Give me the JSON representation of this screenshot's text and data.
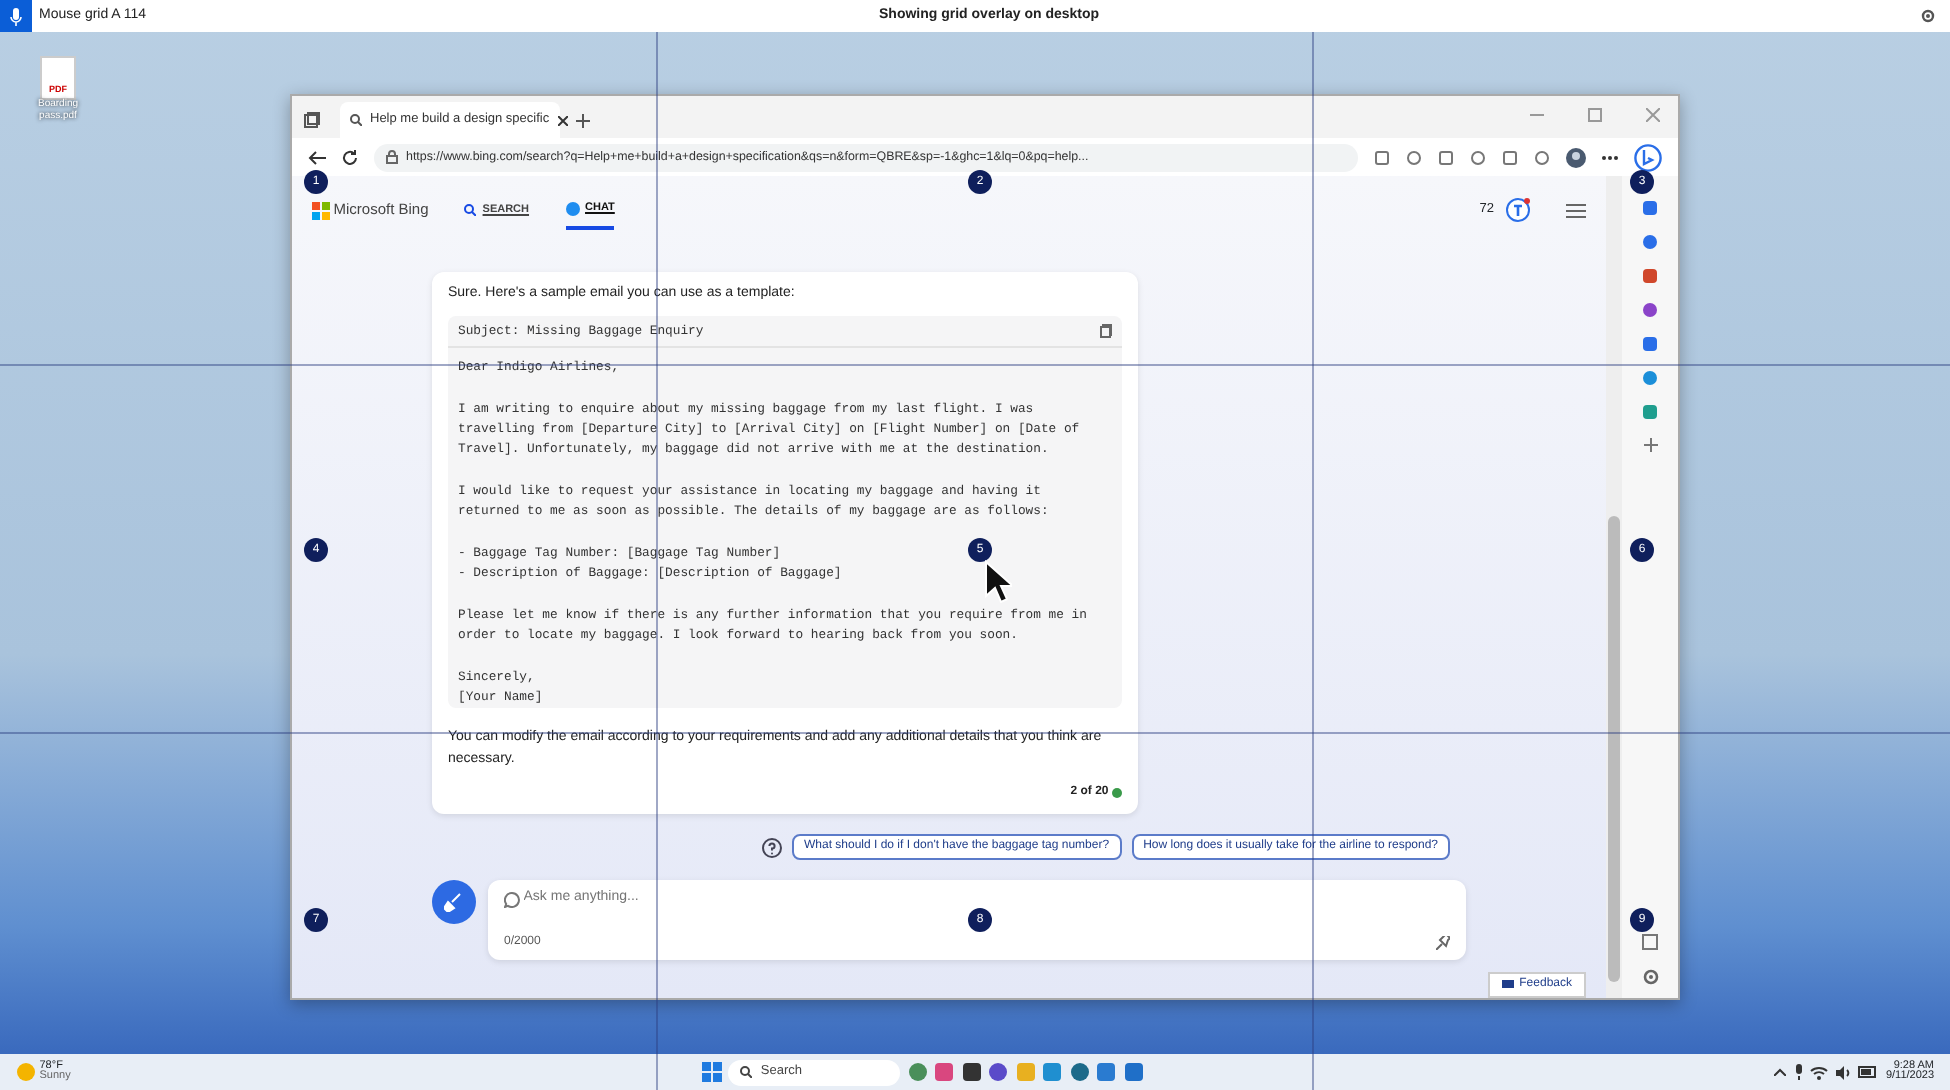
{
  "overlay_bar": {
    "app": "Mouse grid A 114",
    "title": "Showing grid overlay on desktop"
  },
  "desktop_icons": [
    {
      "file_type": "PDF",
      "label": "Boarding pass.pdf"
    }
  ],
  "grid": {
    "markers": [
      "1",
      "2",
      "3",
      "4",
      "5",
      "6",
      "7",
      "8",
      "9"
    ]
  },
  "browser": {
    "tabs": [
      {
        "title": "Help me build a design specific",
        "selected": true
      }
    ],
    "url": "https://www.bing.com/search?q=Help+me+build+a+design+specification&qs=n&form=QBRE&sp=-1&ghc=1&lq=0&pq=help...",
    "bing": {
      "logo": "Microsoft Bing",
      "nav": [
        {
          "label": "SEARCH",
          "selected": false
        },
        {
          "label": "CHAT",
          "selected": true
        }
      ],
      "points": "72"
    },
    "chat": {
      "intro": "Sure. Here's a sample email you can use as a template:",
      "subject": "Subject: Missing Baggage Enquiry",
      "paragraphs": [
        [
          "Dear Indigo Airlines,"
        ],
        [
          "I am writing to enquire about my missing baggage from my last flight. I was",
          "travelling from [Departure City] to [Arrival City] on [Flight Number] on [Date of",
          "Travel]. Unfortunately, my baggage did not arrive with me at the destination."
        ],
        [
          "I would like to request your assistance in locating my baggage and having it",
          "returned to me as soon as possible. The details of my baggage are as follows:"
        ],
        [
          "- Baggage Tag Number: [Baggage Tag Number]",
          "- Description of Baggage: [Description of Baggage]"
        ],
        [
          "Please let me know if there is any further information that you require from me in",
          "order to locate my baggage. I look forward to hearing back from you soon."
        ],
        [
          "Sincerely,",
          "[Your Name]"
        ]
      ],
      "outro": "You can modify the email according to your requirements and add any additional details that you think are necessary.",
      "counter": "2 of 20"
    },
    "suggestions": [
      "What should I do if I don't have the baggage tag number?",
      "How long does it usually take for the airline to respond?"
    ],
    "input": {
      "placeholder": "Ask me anything...",
      "counter": "0/2000"
    },
    "feedback": "Feedback"
  },
  "taskbar": {
    "weather": {
      "temperature": "78°F",
      "condition": "Sunny"
    },
    "search": "Search",
    "time": "9:28 AM",
    "date": "9/11/2023"
  }
}
